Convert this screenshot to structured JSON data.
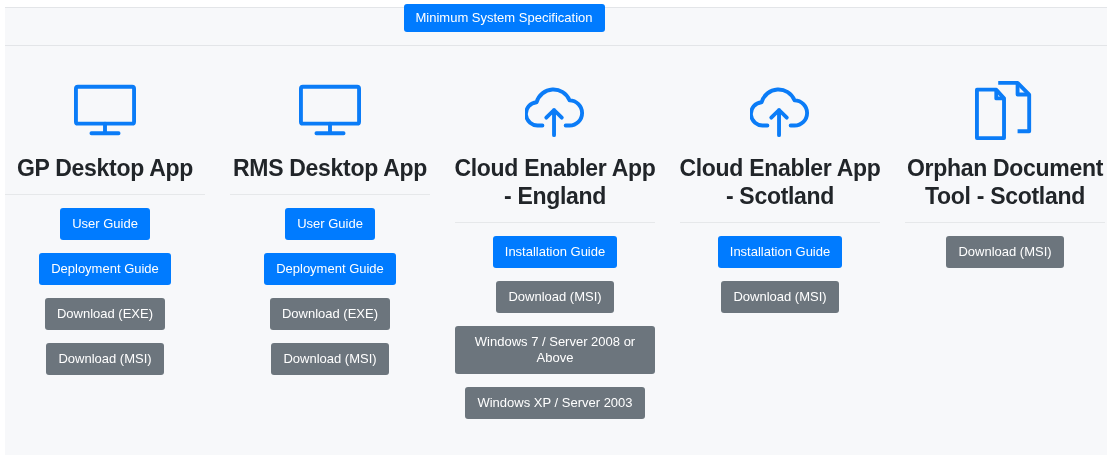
{
  "spec_button": {
    "label": "Minimum System Specification",
    "kind": "primary"
  },
  "apps": [
    {
      "kind": "monitor",
      "title": "GP Desktop App",
      "buttons": [
        {
          "label": "User Guide",
          "kind": "primary"
        },
        {
          "label": "Deployment Guide",
          "kind": "primary"
        },
        {
          "label": "Download (EXE)",
          "kind": "secondary"
        },
        {
          "label": "Download (MSI)",
          "kind": "secondary"
        }
      ]
    },
    {
      "kind": "monitor",
      "title": "RMS Desktop App",
      "buttons": [
        {
          "label": "User Guide",
          "kind": "primary"
        },
        {
          "label": "Deployment Guide",
          "kind": "primary"
        },
        {
          "label": "Download (EXE)",
          "kind": "secondary"
        },
        {
          "label": "Download (MSI)",
          "kind": "secondary"
        }
      ]
    },
    {
      "kind": "cloud",
      "title": "Cloud Enabler App - England",
      "buttons": [
        {
          "label": "Installation Guide",
          "kind": "primary"
        },
        {
          "label": "Download (MSI)",
          "kind": "secondary"
        },
        {
          "label": "Windows 7 / Server 2008 or Above",
          "kind": "secondary"
        },
        {
          "label": "Windows XP / Server 2003",
          "kind": "secondary"
        }
      ]
    },
    {
      "kind": "cloud",
      "title": "Cloud Enabler App - Scotland",
      "buttons": [
        {
          "label": "Installation Guide",
          "kind": "primary"
        },
        {
          "label": "Download (MSI)",
          "kind": "secondary"
        }
      ]
    },
    {
      "kind": "documents",
      "title": "Orphan Document Tool - Scotland",
      "buttons": [
        {
          "label": "Download (MSI)",
          "kind": "secondary"
        }
      ]
    }
  ]
}
